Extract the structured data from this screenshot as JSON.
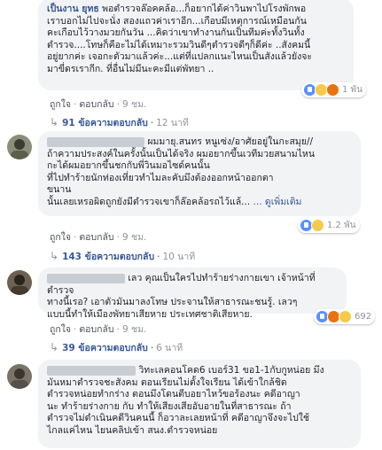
{
  "labels": {
    "like": "ถูกใจ",
    "reply": "ตอบกลับ",
    "see_more": "... ดูเพิ่มเติม"
  },
  "comments": [
    {
      "name_prefix": "เป็นงาน ยุทธ",
      "lines": [
        "พอตำรวจล๊อคคล้อ...ก็อยากได้ค่าวินพาไปโรงพักพอ",
        "เราบอกไม่ไปจะนั่ง สองแถวค่าเราอีก...เกือบมีเหตุการณ์เหมือนกัน",
        "คะเกือบไว้วางมวยกันวัน ...คิดว่าเขาทำงานกันเป็นทีมค่ะทั้งวินทั้ง",
        "ตำรวจ....โทษก็คือะไม่ได้เหมาะรวมวินดีๆตำรวจดีๆก็ดีค่ะ ..สังคมนี้",
        "อยู่ยากค่ะ เจอกะตัวมาแล้วค่ะ...แต่ที่แปลกแนะไหนเป็นสังแล้วยังจะ",
        "มาขี่ดรเรากีก. ที่อื่นไม่มีนะคะมีแต่พัทยา .."
      ],
      "time": "9 ชม.",
      "reactions": "1 พัน",
      "replies_count": "91 ข้อความตอบกลับ",
      "replies_time": "12 นาที"
    },
    {
      "lines": [
        "ผมมายุ.สนทร หนูเซ่ง/อาศัยอยู่ในกะสมุย//",
        "ถ้าความประสงค์ในครั้งนั้นเป็นได้จริง ผมอยากขึ้นเวทีมวยสนามไหน",
        "กะได้ผมอยากขึ้นชกกับพี่วินมอไซด์คนนั้น",
        "ที่ไปทำร้ายนักท่องเที่ยวทำไมละคับมึงต้องออกหน้าออกตา",
        "ขนาน",
        "นั้นเลยเหรอผิดถูกยังมีตำรวจเขาก็ล๊อคล้อรถไว้แล้..."
      ],
      "time": "9 ชม.",
      "reactions": "1.2 พัน",
      "replies_count": "143 ข้อความตอบกลับ",
      "replies_time": "10 นาที"
    },
    {
      "lines": [
        "เลว คุณเป็นใครไปทำร้ายร่างกายเขา เจ้าหน้าที่ตำรวจ",
        "ทางนี้เรอ? เอาตัวมันมาลงโทษ ประจานให้สาธารณะชนรู้. เลวๆ",
        "แบบนี้ทำให้เมืองพัทยาเสียหาย ประเทศชาติเสียหาย."
      ],
      "time": "9 ชม.",
      "reactions": "692",
      "replies_count": "39 ข้อความตอบกลับ",
      "replies_time": "6 นาที"
    },
    {
      "lines": [
        "วิทะเลคอนโคด6 เบอร์31 ขอ1-1กับกูหน่อย มึง",
        "มันหมาตำรวจชะสังคม ตอนเรียนไม่ตั้งใจเรียน ได้เข้าใกล้ชิด",
        "ตำรวจหน่อยทำกร่าง ตอนมึงโดนตีบอยาไหว้ขอร้องนะ คดีอาญา",
        "นะ ทำร้ายร่างกาย กับ ทำให้เสียงเสียอับอายในที่สาธารณะ ถ้า",
        "ตำรวจไม่ดำเนินคดีวินคนนี้ ก็อวาละเลยหน้าที่ คดีอาญาจึงจะไปใช้",
        "ไกลแค่ไหน ไยนคลิปเข้า สนง.ตำรวจหน่อย"
      ]
    }
  ]
}
